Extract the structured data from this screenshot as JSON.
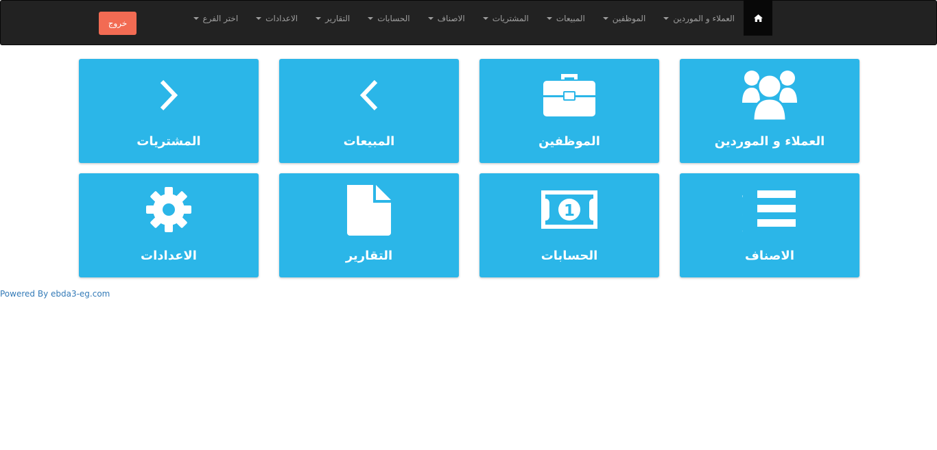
{
  "nav": {
    "home_icon": "home-icon",
    "items": [
      {
        "label": "العملاء و الموردين",
        "has_caret": true
      },
      {
        "label": "الموظفين",
        "has_caret": true
      },
      {
        "label": "المبيعات",
        "has_caret": true
      },
      {
        "label": "المشتريات",
        "has_caret": true
      },
      {
        "label": "الاصناف",
        "has_caret": true
      },
      {
        "label": "الحسابات",
        "has_caret": true
      },
      {
        "label": "التقارير",
        "has_caret": true
      },
      {
        "label": "الاعدادات",
        "has_caret": true
      },
      {
        "label": "اختر الفرع",
        "has_caret": true
      }
    ],
    "logout_label": "خروج"
  },
  "tiles": [
    {
      "label": "العملاء و الموردين",
      "icon": "users-icon"
    },
    {
      "label": "الموظفين",
      "icon": "briefcase-icon"
    },
    {
      "label": "المبيعات",
      "icon": "chevron-left-icon"
    },
    {
      "label": "المشتريات",
      "icon": "chevron-right-icon"
    },
    {
      "label": "الاصناف",
      "icon": "numbered-list-icon"
    },
    {
      "label": "الحسابات",
      "icon": "money-icon"
    },
    {
      "label": "التقارير",
      "icon": "file-icon"
    },
    {
      "label": "الاعدادات",
      "icon": "gear-icon"
    }
  ],
  "footer": {
    "text": "Powered By ebda3-eg.com"
  },
  "colors": {
    "navbar": "#222222",
    "tile": "#2bb6e8",
    "logout": "#f26b53",
    "footer_link": "#337ab7"
  }
}
